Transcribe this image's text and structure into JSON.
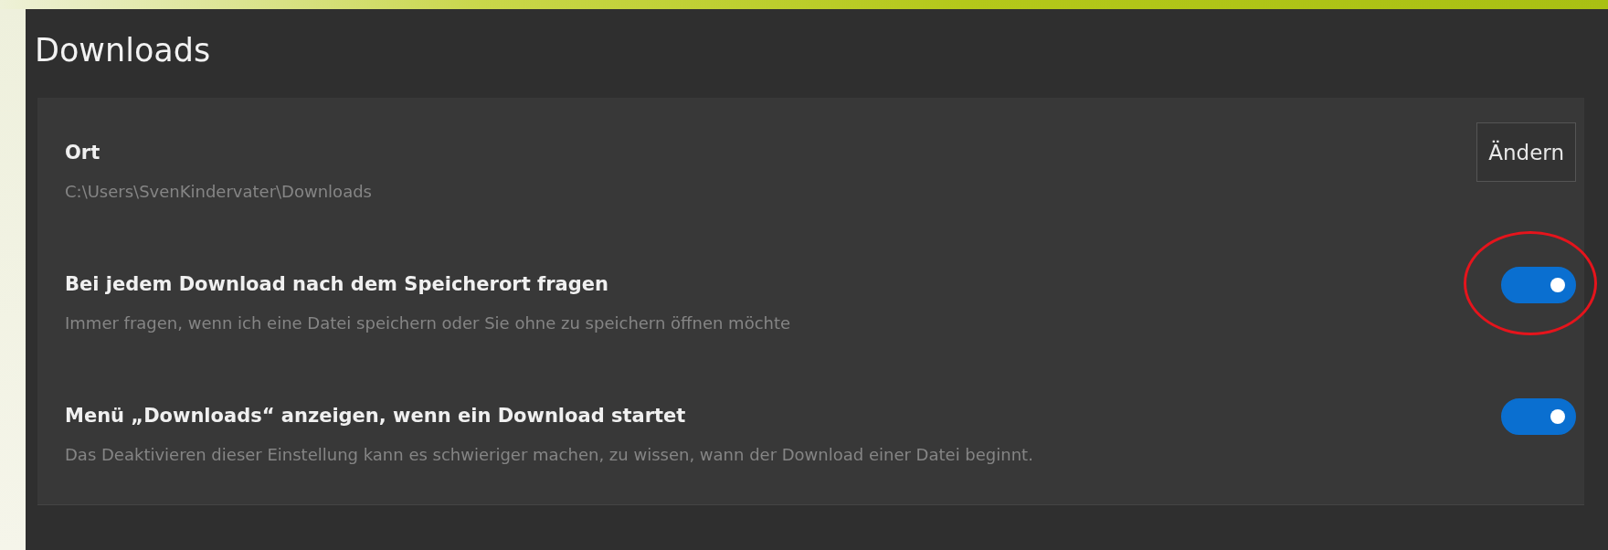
{
  "heading": "Downloads",
  "settings": [
    {
      "kind": "button",
      "title": "Ort",
      "description": "C:\\Users\\SvenKindervater\\Downloads",
      "button": "Ändern",
      "highlighted": false
    },
    {
      "kind": "toggle",
      "title": "Bei jedem Download nach dem Speicherort fragen",
      "description": "Immer fragen, wenn ich eine Datei speichern oder Sie ohne zu speichern öffnen möchte",
      "on": true,
      "highlighted": true
    },
    {
      "kind": "toggle",
      "title": "Menü „Downloads“ anzeigen, wenn ein Download startet",
      "description": "Das Deaktivieren dieser Einstellung kann es schwieriger machen, zu wissen, wann der Download einer Datei beginnt.",
      "on": true,
      "highlighted": false
    }
  ]
}
